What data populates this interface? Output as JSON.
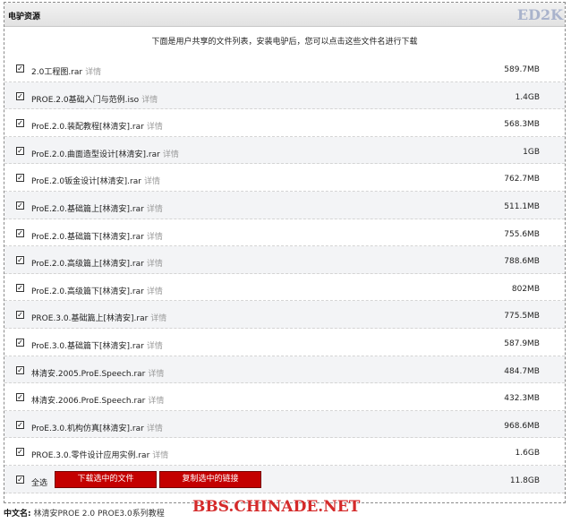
{
  "header": {
    "title": "电驴资源"
  },
  "watermark_top": "ED2K",
  "notice": "下面是用户共享的文件列表，安装电驴后，您可以点击这些文件名进行下载",
  "detail_label": "详情",
  "files": [
    {
      "name": "2.0工程图.rar",
      "size": "589.7MB"
    },
    {
      "name": "PROE.2.0基础入门与范例.iso",
      "size": "1.4GB"
    },
    {
      "name": "ProE.2.0.装配教程[林清安].rar",
      "size": "568.3MB"
    },
    {
      "name": "ProE.2.0.曲面造型设计[林清安].rar",
      "size": "1GB"
    },
    {
      "name": "ProE.2.0钣金设计[林清安].rar",
      "size": "762.7MB"
    },
    {
      "name": "ProE.2.0.基础篇上[林清安].rar",
      "size": "511.1MB"
    },
    {
      "name": "ProE.2.0.基础篇下[林清安].rar",
      "size": "755.6MB"
    },
    {
      "name": "ProE.2.0.高级篇上[林清安].rar",
      "size": "788.6MB"
    },
    {
      "name": "ProE.2.0.高级篇下[林清安].rar",
      "size": "802MB"
    },
    {
      "name": "PROE.3.0.基础篇上[林清安].rar",
      "size": "775.5MB"
    },
    {
      "name": "ProE.3.0.基础篇下[林清安].rar",
      "size": "587.9MB"
    },
    {
      "name": "林清安.2005.ProE.Speech.rar",
      "size": "484.7MB"
    },
    {
      "name": "林清安.2006.ProE.Speech.rar",
      "size": "432.3MB"
    },
    {
      "name": "ProE.3.0.机构仿真[林清安].rar",
      "size": "968.6MB"
    },
    {
      "name": "PROE.3.0.零件设计应用实例.rar",
      "size": "1.6GB"
    }
  ],
  "select_all": {
    "label": "全选",
    "total_size": "11.8GB"
  },
  "buttons": {
    "download_selected": "下载选中的文件",
    "copy_links": "复制选中的链接"
  },
  "footer": {
    "label": "中文名:",
    "value": "林清安PROE 2.0 PROE3.0系列教程"
  },
  "watermark_bottom": "BBS.CHINADE.NET"
}
